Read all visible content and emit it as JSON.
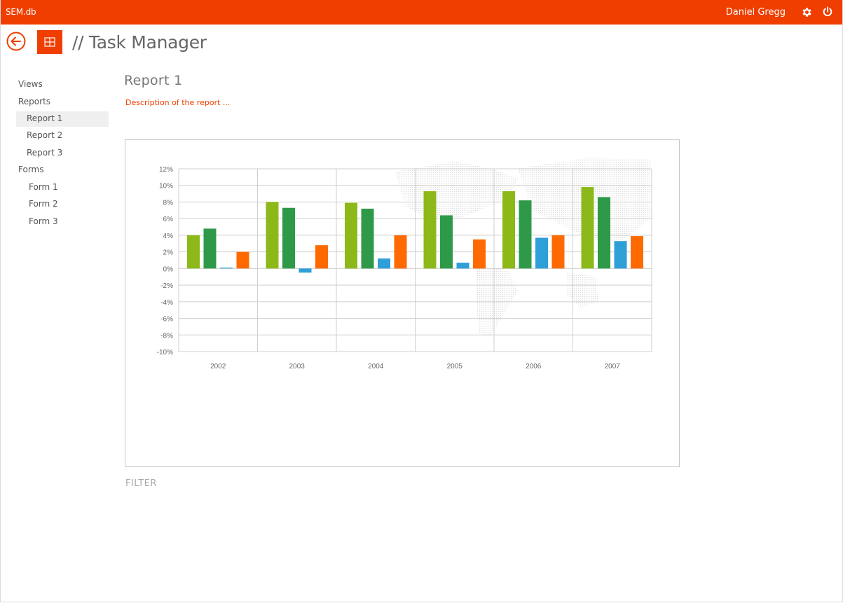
{
  "topbar": {
    "app_name": "SEM.db",
    "user_name": "Daniel Gregg",
    "settings_icon": "gear-icon",
    "power_icon": "power-icon"
  },
  "header": {
    "back_icon": "back-arrow-icon",
    "tile_icon": "grid-icon",
    "title": "// Task Manager"
  },
  "colors": {
    "accent": "#ef3e00",
    "series": [
      "#8cb919",
      "#2e9a49",
      "#2f9fd8",
      "#ff6a00"
    ]
  },
  "nav": {
    "views": "Views",
    "reports": "Reports",
    "report_items": [
      "Report 1",
      "Report 2",
      "Report 3"
    ],
    "forms": "Forms",
    "form_items": [
      "Form 1",
      "Form 2",
      "Form 3"
    ],
    "active": "Report 1"
  },
  "report": {
    "title": "Report  1",
    "description": "Description of the report ..."
  },
  "filter_label": "FILTER",
  "chart_data": {
    "type": "bar",
    "categories": [
      "2002",
      "2003",
      "2004",
      "2005",
      "2006",
      "2007"
    ],
    "series": [
      {
        "values": [
          4.0,
          8.0,
          7.9,
          9.3,
          9.3,
          9.8
        ]
      },
      {
        "values": [
          4.8,
          7.3,
          7.2,
          6.4,
          8.2,
          8.6
        ]
      },
      {
        "values": [
          0.1,
          -0.5,
          1.2,
          0.7,
          3.7,
          3.3
        ]
      },
      {
        "values": [
          2.0,
          2.8,
          4.0,
          3.5,
          4.0,
          3.9
        ]
      }
    ],
    "ylim": [
      -10,
      12
    ],
    "yticks": [
      "12%",
      "10%",
      "8%",
      "6%",
      "4%",
      "2%",
      "0%",
      "-2%",
      "-4%",
      "-6%",
      "-8%",
      "-10%"
    ],
    "grid": true,
    "legend": "none",
    "title": "",
    "xlabel": "",
    "ylabel": ""
  }
}
